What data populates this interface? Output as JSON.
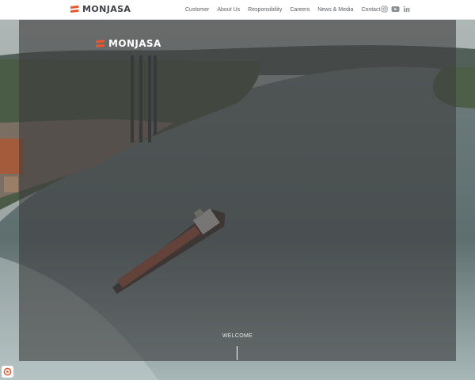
{
  "header": {
    "brand": "MONJASA",
    "nav": [
      "Customer",
      "About Us",
      "Responsibility",
      "Careers",
      "News & Media",
      "Contact"
    ],
    "social_icons": [
      "instagram-icon",
      "youtube-icon",
      "linkedin-icon"
    ]
  },
  "hero": {
    "brand": "MONJASA",
    "welcome": "WELCOME"
  },
  "colors": {
    "brand_orange": "#e8562a",
    "logo_gray": "#3f4348",
    "overlay": "rgba(62,62,62,0.62)"
  }
}
